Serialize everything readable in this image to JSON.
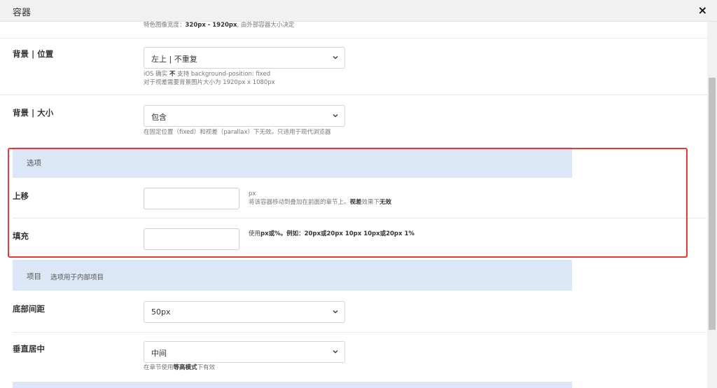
{
  "dialog": {
    "title": "容器",
    "close_label": "×"
  },
  "top_help": {
    "prefix": "特色图像宽度：",
    "bold": "320px - 1920px",
    "suffix": ", 由外部容器大小决定"
  },
  "bg_position": {
    "label": "背景 | 位置",
    "value": "左上 | 不重复",
    "help1_prefix": "iOS 确实 ",
    "help1_bold": "不",
    "help1_suffix": " 支持 background-position: fixed",
    "help2": "对于视差需要背景图片大小为 1920px x 1080px"
  },
  "bg_size": {
    "label": "背景 | 大小",
    "value": "包含",
    "help": "在固定位置（fixed）和视差（parallax）下无效。只适用于现代浏览器"
  },
  "options_section": {
    "title": "选项"
  },
  "move_up": {
    "label": "上移",
    "value": "",
    "help_unit": "px",
    "help_prefix": "将该容器移动到叠加在前面的章节上。",
    "help_bold1": "视差",
    "help_mid": "效果下",
    "help_bold2": "无效"
  },
  "padding": {
    "label": "填充",
    "value": "",
    "help_prefix": "使用",
    "help_bold": "px或%。例如：20px或20px 10px 10px或20px 1%"
  },
  "items_section": {
    "title": "项目",
    "subtitle": "选项用于内部项目"
  },
  "bottom_margin": {
    "label": "底部间距",
    "value": "50px"
  },
  "vertical_center": {
    "label": "垂直居中",
    "value": "中间",
    "help_prefix": "在章节使用",
    "help_bold": "等高模式",
    "help_suffix": "下有效"
  },
  "colors": {
    "highlight": "#e53935",
    "section_bg": "#dbe6f6"
  }
}
